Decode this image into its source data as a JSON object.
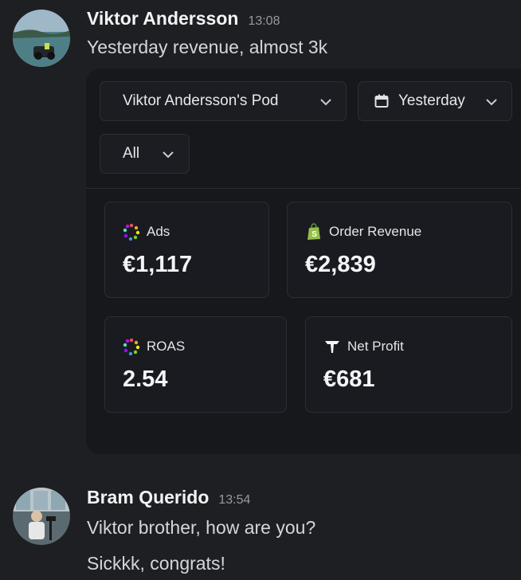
{
  "messages": [
    {
      "author": "Viktor Andersson",
      "time": "13:08",
      "lines": [
        "Yesterday revenue, almost 3k"
      ]
    },
    {
      "author": "Bram Querido",
      "time": "13:54",
      "lines": [
        "Viktor brother, how are you?",
        "Sickkk, congrats!"
      ]
    }
  ],
  "embed": {
    "filters": {
      "pod": "Viktor Andersson's Pod",
      "date": "Yesterday",
      "scope": "All"
    },
    "metrics": [
      {
        "label": "Ads",
        "value": "€1,117",
        "icon": "ads-dots-icon"
      },
      {
        "label": "Order Revenue",
        "value": "€2,839",
        "icon": "shopify-icon"
      },
      {
        "label": "ROAS",
        "value": "2.54",
        "icon": "roas-dots-icon"
      },
      {
        "label": "Net Profit",
        "value": "€681",
        "icon": "triple-whale-icon"
      }
    ]
  },
  "colors": {
    "background": "#1e1f22",
    "embed": "#17181c",
    "shopify_green": "#95bf47"
  }
}
